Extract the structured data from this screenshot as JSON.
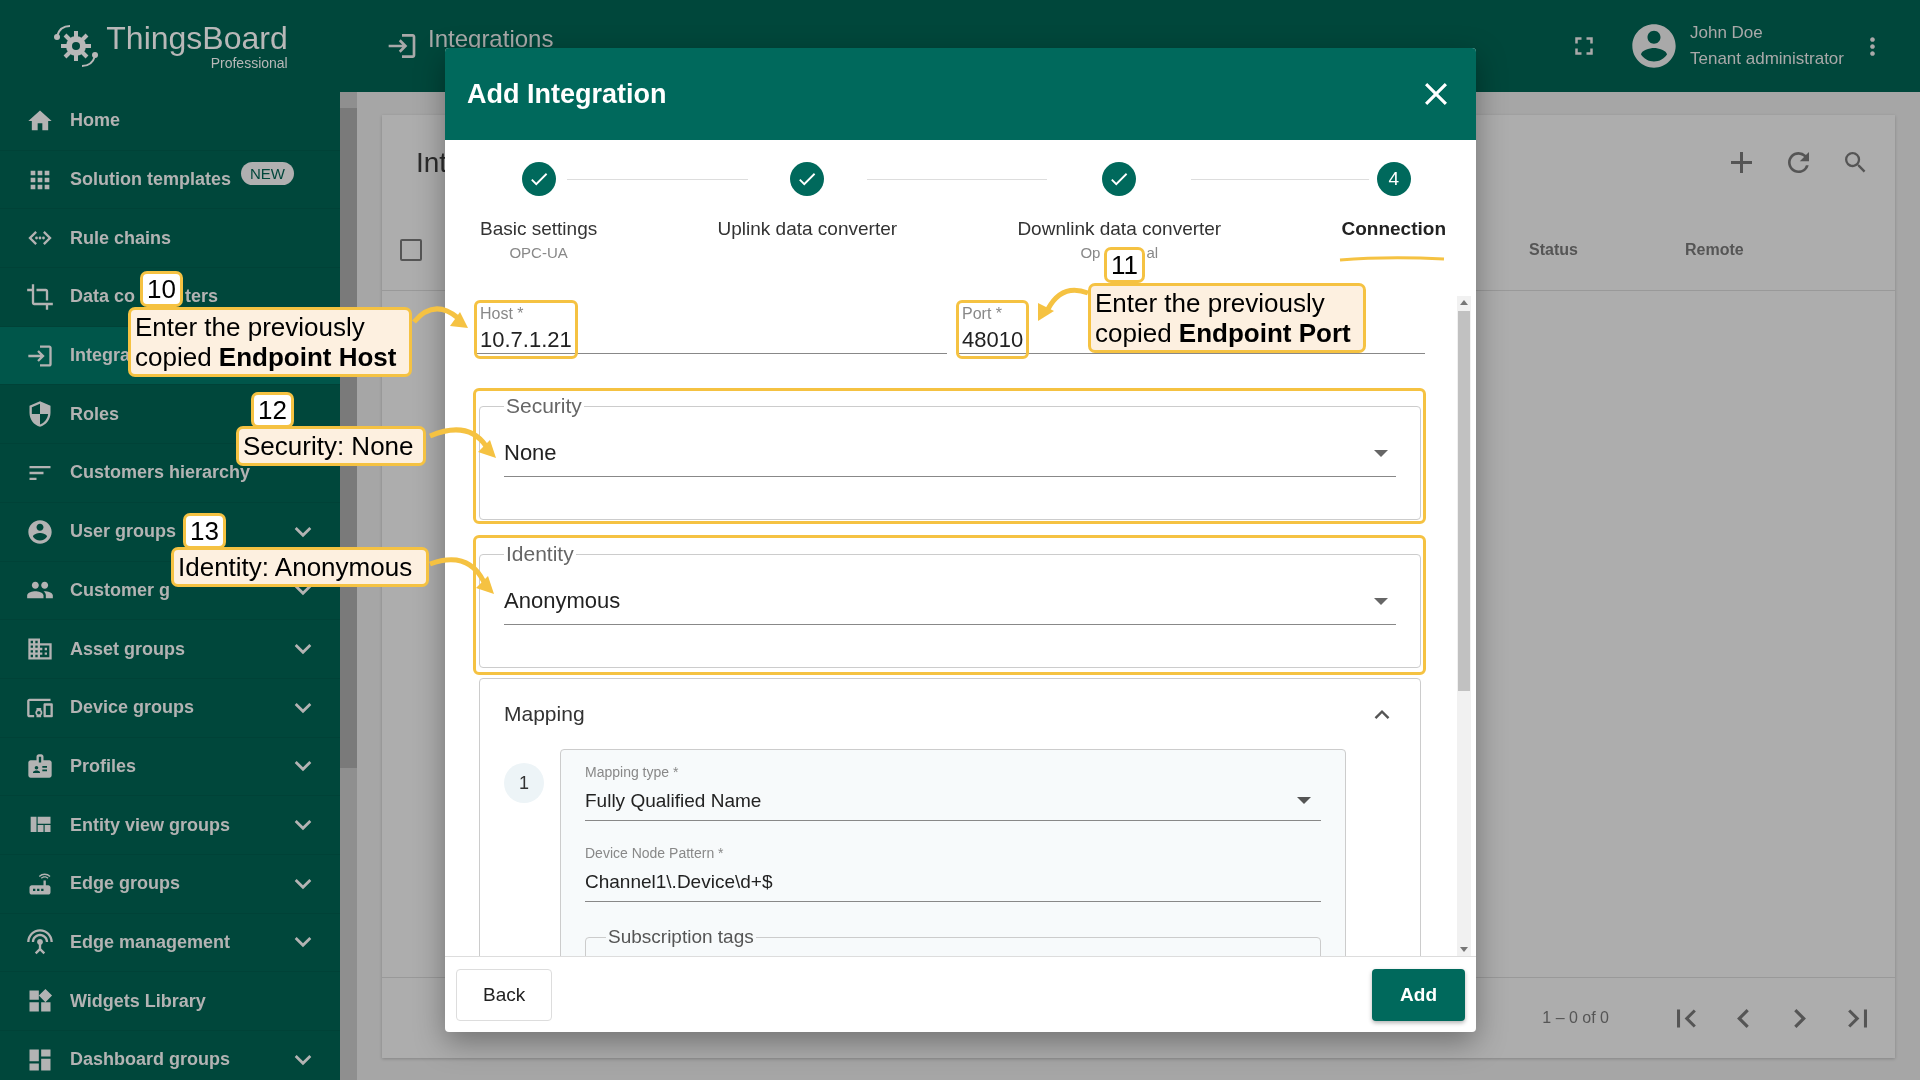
{
  "app": {
    "logo_text": "ThingsBoard",
    "logo_subtitle": "Professional"
  },
  "sidebar": {
    "items": [
      {
        "label": "Home",
        "kind": "link",
        "selected": false
      },
      {
        "label": "Solution templates",
        "kind": "link",
        "badge": "NEW",
        "selected": false
      },
      {
        "label": "Rule chains",
        "kind": "link",
        "selected": false
      },
      {
        "label": "Data co",
        "label_tail": "ters",
        "kind": "link",
        "selected": false
      },
      {
        "label": "Integra",
        "kind": "link",
        "selected": true
      },
      {
        "label": "Roles",
        "kind": "link",
        "selected": false
      },
      {
        "label": "Customers hierarchy",
        "kind": "link",
        "selected": false
      },
      {
        "label": "User groups",
        "kind": "group",
        "selected": false
      },
      {
        "label": "Customer g",
        "kind": "group",
        "selected": false
      },
      {
        "label": "Asset groups",
        "kind": "group",
        "selected": false
      },
      {
        "label": "Device groups",
        "kind": "group",
        "selected": false
      },
      {
        "label": "Profiles",
        "kind": "group",
        "selected": false
      },
      {
        "label": "Entity view groups",
        "kind": "group",
        "selected": false
      },
      {
        "label": "Edge groups",
        "kind": "group",
        "selected": false
      },
      {
        "label": "Edge management",
        "kind": "group",
        "selected": false
      },
      {
        "label": "Widgets Library",
        "kind": "link",
        "selected": false
      },
      {
        "label": "Dashboard groups",
        "kind": "group",
        "selected": false
      }
    ]
  },
  "header": {
    "title": "Integrations",
    "user_name": "John Doe",
    "user_role": "Tenant administrator"
  },
  "page": {
    "title": "Int",
    "select_all_checked": false,
    "columns": [
      "Status",
      "Remote"
    ],
    "paginator": "1 – 0 of 0"
  },
  "dialog": {
    "title": "Add Integration",
    "steps": [
      {
        "label": "Basic settings",
        "sublabel": "OPC-UA",
        "done": true,
        "selected": false
      },
      {
        "label": "Uplink data converter",
        "done": true,
        "selected": false
      },
      {
        "label": "Downlink data converter",
        "sublabel": "Op",
        "sublabel_tail": "al",
        "done": true,
        "selected": false
      },
      {
        "label": "Connection",
        "number": "4",
        "done": false,
        "selected": true
      }
    ],
    "host": {
      "label": "Host *",
      "value": "10.7.1.21"
    },
    "port": {
      "label": "Port *",
      "value": "48010"
    },
    "security": {
      "legend": "Security",
      "value": "None"
    },
    "identity": {
      "legend": "Identity",
      "value": "Anonymous"
    },
    "mapping": {
      "title": "Mapping",
      "expanded": true,
      "index": "1",
      "mapping_type": {
        "label": "Mapping type *",
        "value": "Fully Qualified Name"
      },
      "device_node_pattern": {
        "label": "Device Node Pattern *",
        "value": "Channel1\\.Device\\d+$"
      },
      "subscription_tags": "Subscription tags"
    },
    "buttons": {
      "back": "Back",
      "add": "Add"
    }
  },
  "annotations": [
    {
      "number": "10",
      "text": "Enter the previously\ncopied **Endpoint Host**"
    },
    {
      "number": "11",
      "text": "Enter the previously\ncopied **Endpoint Port**"
    },
    {
      "number": "12",
      "text": "Security: None"
    },
    {
      "number": "13",
      "text": "Identity: Anonymous"
    }
  ]
}
